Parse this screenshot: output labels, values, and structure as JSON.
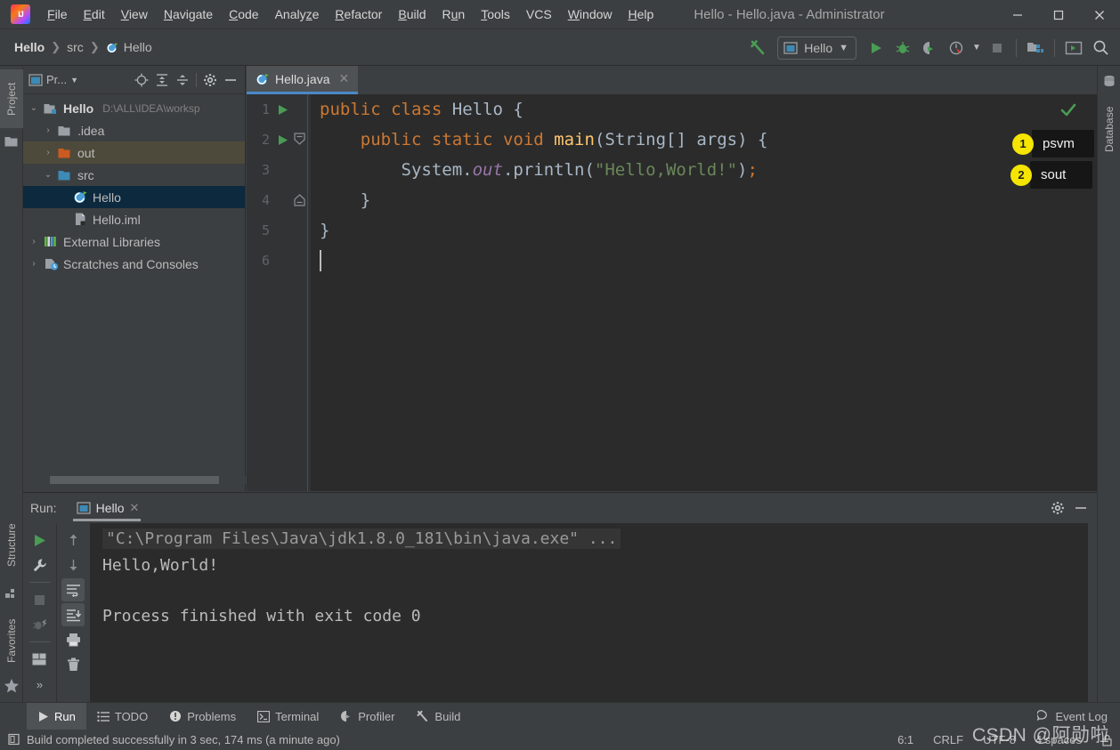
{
  "window": {
    "title": "Hello - Hello.java - Administrator",
    "minimize": "—",
    "maximize": "▢",
    "close": "✕"
  },
  "menu": [
    {
      "label": "File",
      "mnemonic": "F"
    },
    {
      "label": "Edit",
      "mnemonic": "E"
    },
    {
      "label": "View",
      "mnemonic": "V"
    },
    {
      "label": "Navigate",
      "mnemonic": "N"
    },
    {
      "label": "Code",
      "mnemonic": "C"
    },
    {
      "label": "Analyze",
      "mnemonic": "z"
    },
    {
      "label": "Refactor",
      "mnemonic": "R"
    },
    {
      "label": "Build",
      "mnemonic": "B"
    },
    {
      "label": "Run",
      "mnemonic": "u"
    },
    {
      "label": "Tools",
      "mnemonic": "T"
    },
    {
      "label": "VCS",
      "mnemonic": ""
    },
    {
      "label": "Window",
      "mnemonic": "W"
    },
    {
      "label": "Help",
      "mnemonic": "H"
    }
  ],
  "breadcrumb": {
    "project": "Hello",
    "folder": "src",
    "file": "Hello",
    "separator": "❯"
  },
  "toolbar": {
    "build_icon": "hammer-icon",
    "run_config": "Hello",
    "dropdown_caret": "▾",
    "run_icon": "run-icon",
    "debug_icon": "debug-icon",
    "coverage_icon": "run-with-coverage-icon",
    "profile_icon": "profiler-icon",
    "stop_icon": "stop-icon",
    "structure_icon": "project-structure-icon",
    "terminal_icon": "run-anything-icon",
    "search_icon": "search-everywhere-icon"
  },
  "left_strip": [
    {
      "label": "Project",
      "selected": true
    },
    {
      "label": "Structure",
      "selected": false
    },
    {
      "label": "Favorites",
      "selected": false
    }
  ],
  "right_strip": [
    {
      "label": "Database",
      "selected": false
    }
  ],
  "project_panel": {
    "title": "Pr...",
    "title_caret": "▾",
    "icons": [
      "locate-icon",
      "expand-all-icon",
      "collapse-all-icon",
      "gear-icon",
      "hide-icon"
    ],
    "tree": [
      {
        "id": "hello-root",
        "label": "Hello",
        "path": "D:\\ALL\\IDEA\\worksp",
        "arrow": "⌄",
        "indent": 0,
        "icon": "module-folder-icon",
        "state": "normal",
        "bold": true
      },
      {
        "id": "idea",
        "label": ".idea",
        "path": "",
        "arrow": "›",
        "indent": 1,
        "icon": "folder-icon",
        "state": "normal",
        "bold": false
      },
      {
        "id": "out",
        "label": "out",
        "path": "",
        "arrow": "›",
        "indent": 1,
        "icon": "excluded-folder-icon",
        "state": "highlight",
        "bold": false
      },
      {
        "id": "src",
        "label": "src",
        "path": "",
        "arrow": "⌄",
        "indent": 1,
        "icon": "source-folder-icon",
        "state": "normal",
        "bold": false
      },
      {
        "id": "hello-class",
        "label": "Hello",
        "path": "",
        "arrow": "",
        "indent": 2,
        "icon": "java-class-icon",
        "state": "selected",
        "bold": false
      },
      {
        "id": "hello-iml",
        "label": "Hello.iml",
        "path": "",
        "arrow": "",
        "indent": 2,
        "icon": "iml-file-icon",
        "state": "normal",
        "bold": false
      },
      {
        "id": "external-libraries",
        "label": "External Libraries",
        "path": "",
        "arrow": "›",
        "indent": 0,
        "icon": "libraries-icon",
        "state": "normal",
        "bold": false
      },
      {
        "id": "scratches",
        "label": "Scratches and Consoles",
        "path": "",
        "arrow": "›",
        "indent": 0,
        "icon": "scratches-icon",
        "state": "normal",
        "bold": false
      }
    ]
  },
  "editor": {
    "tab": {
      "label": "Hello.java",
      "icon": "java-class-icon",
      "close": "✕"
    },
    "inspection_status": "✔",
    "lines": [
      {
        "num": "1",
        "run_marker": true,
        "fold": "",
        "tokens": [
          {
            "t": "public",
            "c": "kw"
          },
          {
            "t": " ",
            "c": "pln"
          },
          {
            "t": "class",
            "c": "kw"
          },
          {
            "t": " ",
            "c": "pln"
          },
          {
            "t": "Hello",
            "c": "cls"
          },
          {
            "t": " {",
            "c": "pln"
          }
        ]
      },
      {
        "num": "2",
        "run_marker": true,
        "fold": "expanded-down",
        "tokens": [
          {
            "t": "    ",
            "c": "pln"
          },
          {
            "t": "public",
            "c": "kw"
          },
          {
            "t": " ",
            "c": "pln"
          },
          {
            "t": "static",
            "c": "kw"
          },
          {
            "t": " ",
            "c": "pln"
          },
          {
            "t": "void",
            "c": "kw"
          },
          {
            "t": " ",
            "c": "pln"
          },
          {
            "t": "main",
            "c": "mth"
          },
          {
            "t": "(String[] args) {",
            "c": "pln"
          }
        ]
      },
      {
        "num": "3",
        "run_marker": false,
        "fold": "",
        "tokens": [
          {
            "t": "        ",
            "c": "pln"
          },
          {
            "t": "System",
            "c": "cls"
          },
          {
            "t": ".",
            "c": "pln"
          },
          {
            "t": "out",
            "c": "fld"
          },
          {
            "t": ".println(",
            "c": "pln"
          },
          {
            "t": "\"Hello,World!\"",
            "c": "str"
          },
          {
            "t": ")",
            "c": "pln"
          },
          {
            "t": ";",
            "c": "semi"
          }
        ]
      },
      {
        "num": "4",
        "run_marker": false,
        "fold": "expanded-up",
        "tokens": [
          {
            "t": "    }",
            "c": "pln"
          }
        ]
      },
      {
        "num": "5",
        "run_marker": false,
        "fold": "",
        "tokens": [
          {
            "t": "}",
            "c": "pln"
          }
        ]
      },
      {
        "num": "6",
        "run_marker": false,
        "fold": "",
        "tokens": []
      }
    ],
    "annotations": [
      {
        "num": "1",
        "text": "psvm",
        "line": 2
      },
      {
        "num": "2",
        "text": "sout",
        "line": 3
      }
    ]
  },
  "run_panel": {
    "label": "Run:",
    "tab": {
      "label": "Hello",
      "icon": "run-config-icon",
      "close": "✕"
    },
    "header_icons": [
      "gear-icon",
      "hide-icon"
    ],
    "tools_left": [
      "rerun-icon",
      "wrench-icon",
      "stop-icon",
      "kill-process-icon",
      "layout-icon",
      "more-icon"
    ],
    "tools_right": [
      "up-arrow-icon",
      "down-arrow-icon",
      "soft-wrap-icon",
      "scroll-to-end-icon",
      "print-icon",
      "trash-icon"
    ],
    "console": {
      "command": "\"C:\\Program Files\\Java\\jdk1.8.0_181\\bin\\java.exe\" ...",
      "output": "Hello,World!",
      "exit": "Process finished with exit code 0"
    }
  },
  "bottom_bar": {
    "items": [
      {
        "label": "Run",
        "icon": "run-icon",
        "selected": true
      },
      {
        "label": "TODO",
        "icon": "todo-icon",
        "selected": false
      },
      {
        "label": "Problems",
        "icon": "problems-icon",
        "selected": false
      },
      {
        "label": "Terminal",
        "icon": "terminal-icon",
        "selected": false
      },
      {
        "label": "Profiler",
        "icon": "profiler-icon",
        "selected": false
      },
      {
        "label": "Build",
        "icon": "build-icon",
        "selected": false
      }
    ],
    "event_log": {
      "label": "Event Log",
      "icon": "event-log-icon"
    }
  },
  "status_bar": {
    "message": "Build completed successfully in 3 sec, 174 ms (a minute ago)",
    "caret_position": "6:1",
    "line_separator": "CRLF",
    "encoding": "UTF-8",
    "indent": "4 spaces"
  },
  "watermark": "CSDN @阿勋啦",
  "colors": {
    "panel_bg": "#3c3f41",
    "editor_bg": "#2b2b2b",
    "gutter_bg": "#313335",
    "selection_blue": "#0d293e",
    "excluded_highlight": "#4e4a3b",
    "accent_blue": "#4a88c7",
    "keyword_orange": "#cc7832",
    "method_yellow": "#ffc66d",
    "string_green": "#6a8759",
    "field_purple": "#9876aa",
    "text_grey": "#a9b7c6",
    "badge_yellow": "#f5e500",
    "run_green": "#499c54"
  }
}
